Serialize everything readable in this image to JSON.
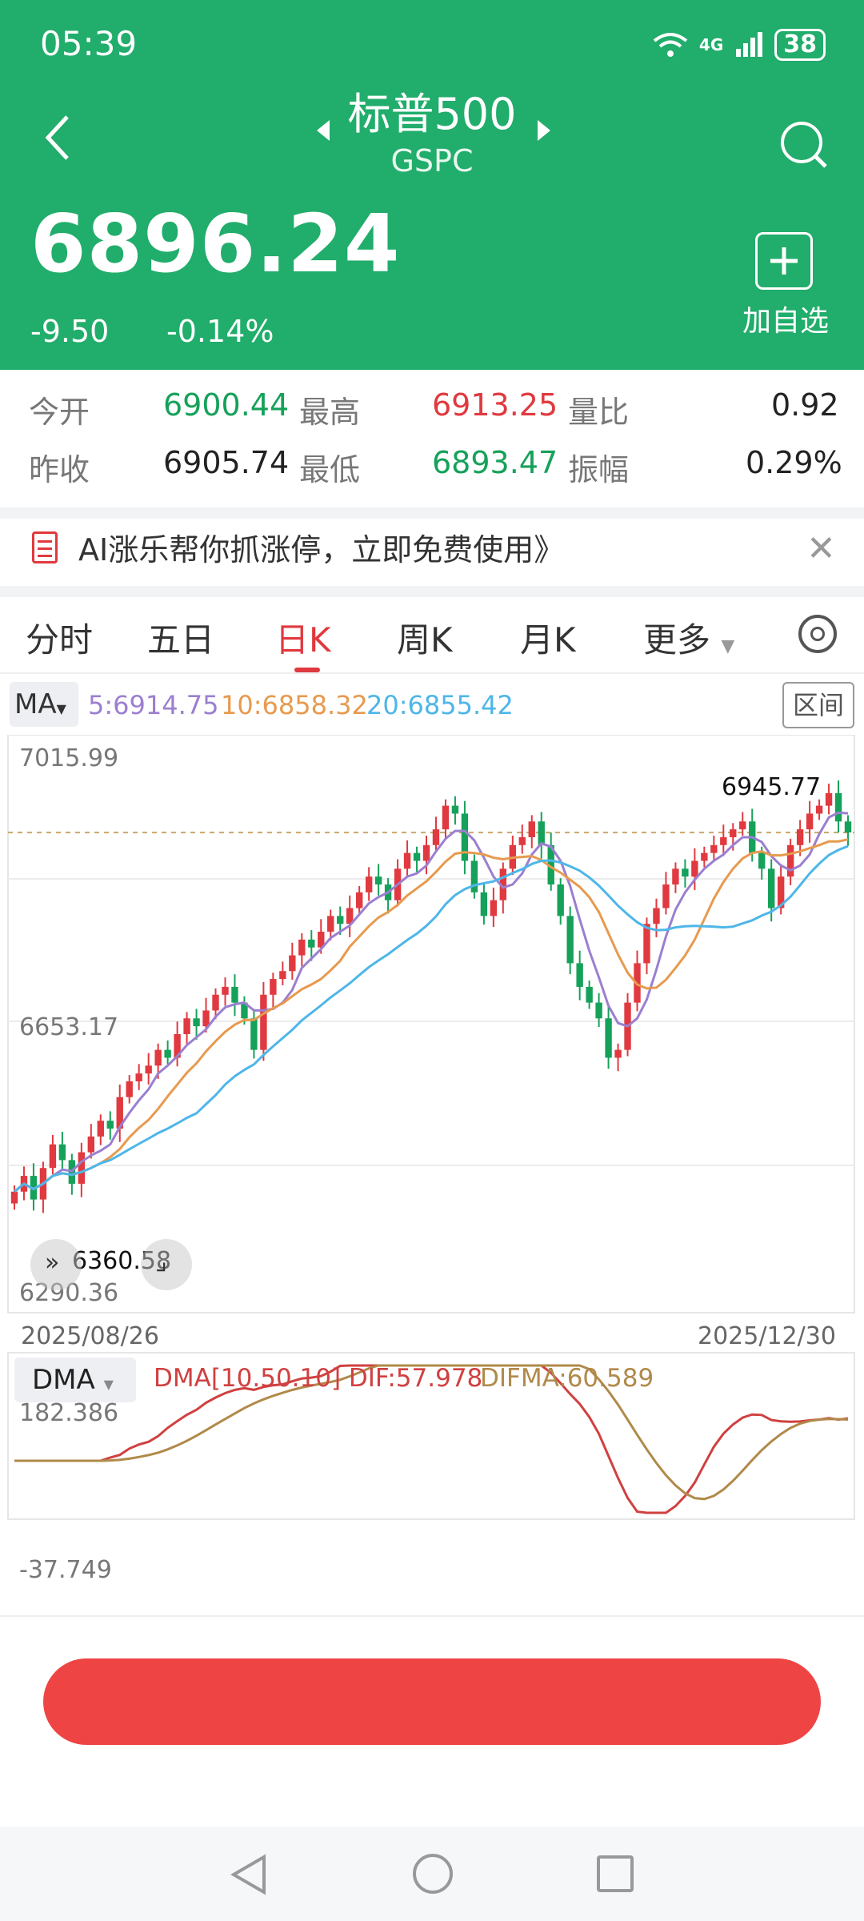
{
  "status_bar": {
    "time": "05:39",
    "network": "4G",
    "battery": "38"
  },
  "header": {
    "title": "标普500",
    "code": "GSPC",
    "price": "6896.24",
    "change": "-9.50",
    "change_pct": "-0.14%",
    "add_watchlist_label": "加自选"
  },
  "stats": {
    "open_label": "今开",
    "open": "6900.44",
    "high_label": "最高",
    "high": "6913.25",
    "volratio_label": "量比",
    "volratio": "0.92",
    "prevclose_label": "昨收",
    "prevclose": "6905.74",
    "low_label": "最低",
    "low": "6893.47",
    "amplitude_label": "振幅",
    "amplitude": "0.29%"
  },
  "ai_banner": {
    "text": "AI涨乐帮你抓涨停，立即免费使用》"
  },
  "tabs": [
    {
      "label": "分时"
    },
    {
      "label": "五日"
    },
    {
      "label": "日K",
      "active": true
    },
    {
      "label": "周K"
    },
    {
      "label": "月K"
    },
    {
      "label": "更多"
    }
  ],
  "indicator_bar": {
    "selector": "MA",
    "ma5": "5:6914.75",
    "ma10": "10:6858.32",
    "ma20": "20:6855.42",
    "range_button": "区间"
  },
  "kline_axis": {
    "y_high": "7015.99",
    "y_mid": "6653.17",
    "y_low": "6290.36",
    "date_start": "2025/08/26",
    "date_end": "2025/12/30",
    "max_marker": "6945.77",
    "min_marker": "6360.58"
  },
  "dma": {
    "selector": "DMA",
    "params": "DMA[10.50.10] DIF:57.978",
    "difma": "DIFMA:60.589",
    "y_high": "182.386",
    "y_low": "-37.749"
  },
  "colors": {
    "header_bg": "#21ad6b",
    "up": "#e0393f",
    "down": "#16a15a",
    "ma5": "#9b7fd0",
    "ma10": "#e79a4e",
    "ma20": "#4eb6e8",
    "dif": "#d04040",
    "difma": "#b08a4a"
  },
  "chart_data": [
    {
      "type": "candlestick",
      "title": "",
      "ylim": [
        6290.36,
        7015.99
      ],
      "x_range": [
        "2025/08/26",
        "2025/12/30"
      ],
      "series": [
        {
          "name": "MA5",
          "last": 6914.75
        },
        {
          "name": "MA10",
          "last": 6858.32
        },
        {
          "name": "MA20",
          "last": 6855.42
        }
      ],
      "close": [
        6440,
        6460,
        6430,
        6470,
        6500,
        6480,
        6450,
        6490,
        6510,
        6530,
        6520,
        6560,
        6580,
        6590,
        6600,
        6620,
        6610,
        6640,
        6660,
        6650,
        6670,
        6690,
        6700,
        6680,
        6660,
        6620,
        6690,
        6710,
        6720,
        6740,
        6760,
        6750,
        6770,
        6790,
        6780,
        6800,
        6820,
        6840,
        6830,
        6810,
        6850,
        6870,
        6860,
        6880,
        6900,
        6930,
        6920,
        6860,
        6820,
        6790,
        6810,
        6850,
        6880,
        6890,
        6910,
        6880,
        6830,
        6790,
        6730,
        6700,
        6680,
        6660,
        6610,
        6620,
        6680,
        6730,
        6780,
        6800,
        6830,
        6850,
        6840,
        6860,
        6870,
        6880,
        6890,
        6900,
        6910,
        6870,
        6850,
        6800,
        6840,
        6880,
        6900,
        6920,
        6930,
        6946,
        6910,
        6896
      ],
      "annotations": {
        "max": 6945.77,
        "min": 6360.58
      }
    },
    {
      "type": "line",
      "title": "",
      "ylim": [
        -37.749,
        182.386
      ],
      "series": [
        {
          "name": "DIF",
          "last": 57.978
        },
        {
          "name": "DIFMA",
          "last": 60.589
        }
      ]
    }
  ]
}
